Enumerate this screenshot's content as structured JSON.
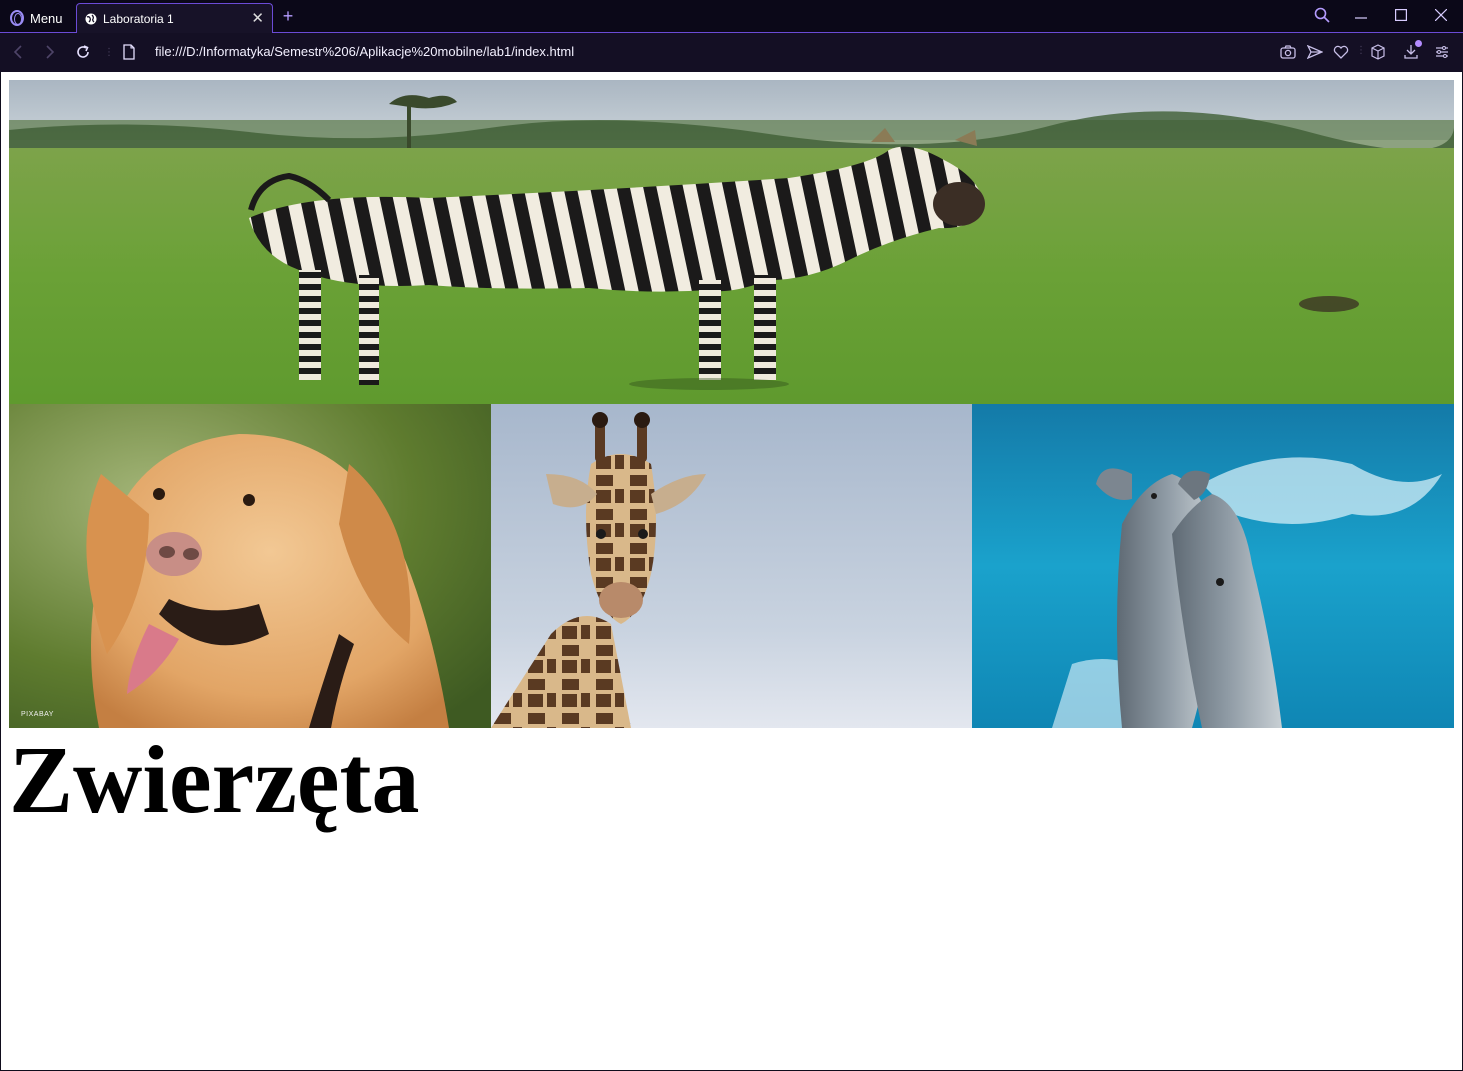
{
  "browser": {
    "menu_label": "Menu",
    "tab": {
      "title": "Laboratoria 1"
    },
    "url": "file:///D:/Informatyka/Semestr%206/Aplikacje%20mobilne/lab1/index.html",
    "accent_color": "#6b4bd6"
  },
  "page": {
    "heading": "Zwierzęta",
    "images": [
      {
        "subject": "zebra"
      },
      {
        "subject": "dog",
        "watermark": "PIXABAY"
      },
      {
        "subject": "giraffe"
      },
      {
        "subject": "dolphins"
      }
    ]
  }
}
